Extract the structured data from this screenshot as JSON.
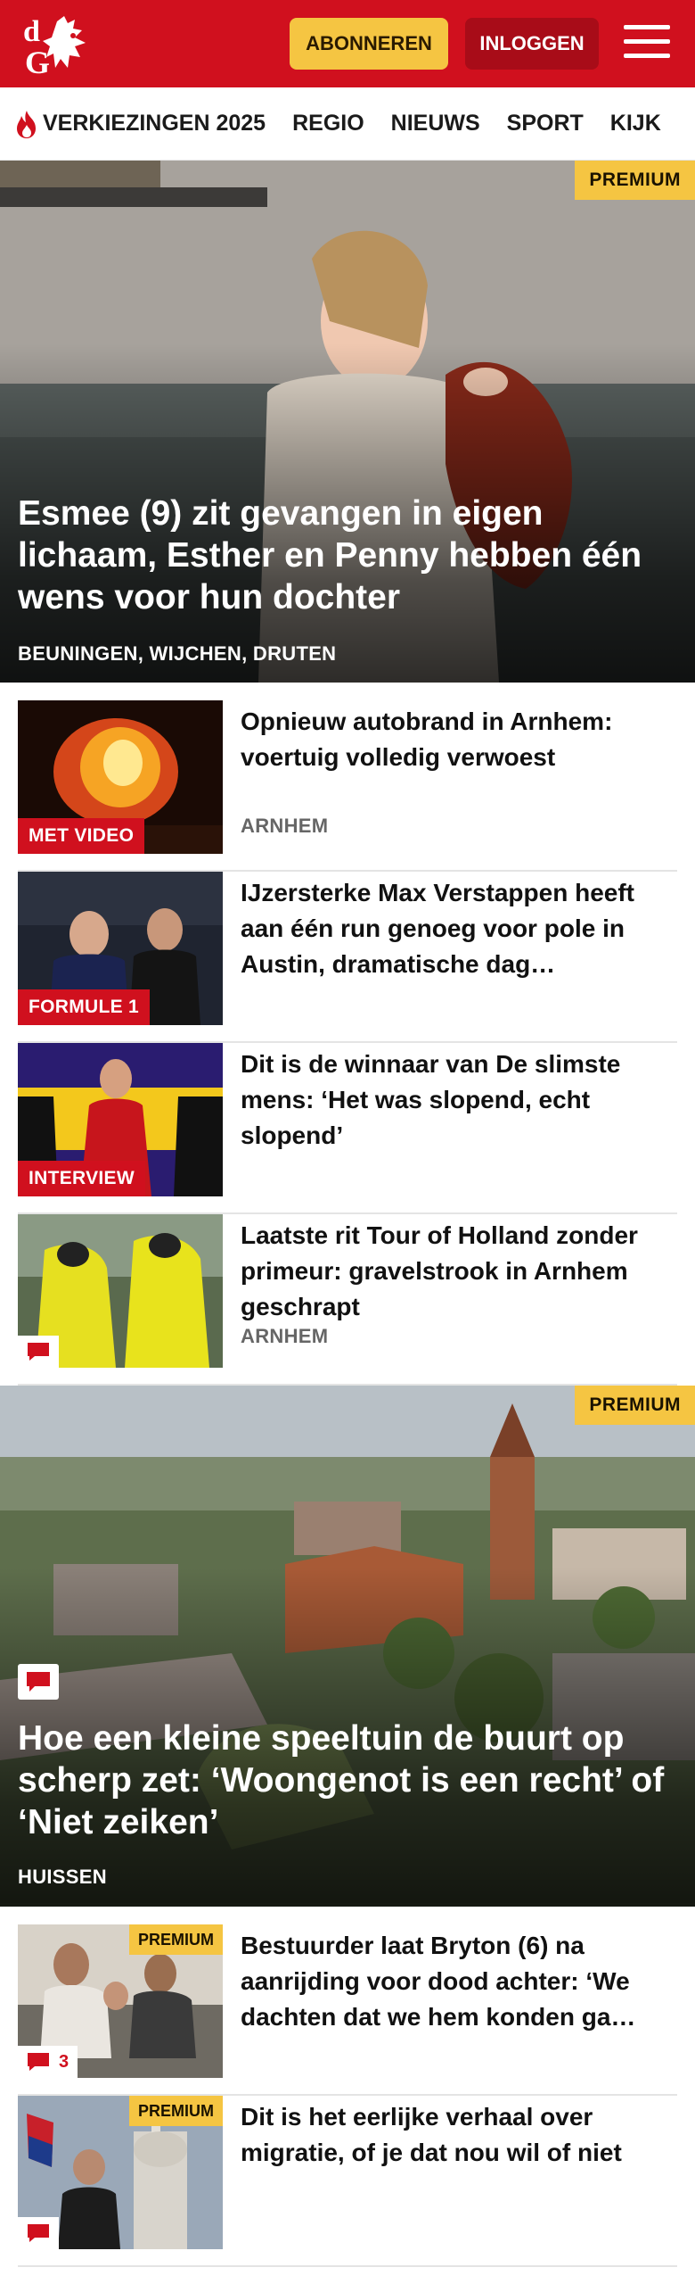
{
  "header": {
    "subscribe_label": "ABONNEREN",
    "login_label": "INLOGGEN",
    "menu_icon": "hamburger-menu-icon",
    "logo_text": "dG",
    "brand_color": "#d0101e",
    "accent_color": "#f5c542"
  },
  "nav": {
    "items": [
      {
        "label": "VERKIEZINGEN 2025",
        "icon": "flame-icon"
      },
      {
        "label": "REGIO"
      },
      {
        "label": "NIEUWS"
      },
      {
        "label": "SPORT"
      },
      {
        "label": "KIJK"
      }
    ]
  },
  "stories": {
    "hero1": {
      "badge": "PREMIUM",
      "title": "Esmee (9) zit gevangen in eigen lichaam, Esther en Penny hebben één wens voor hun dochter",
      "location": "BEUNINGEN, WIJCHEN, DRUTEN"
    },
    "list1": [
      {
        "label": "MET VIDEO",
        "title": "Opnieuw autobrand in Arnhem: voertuig volledig verwoest",
        "location": "ARNHEM"
      },
      {
        "label": "FORMULE 1",
        "title": "IJzersterke Max Verstappen heeft aan één run genoeg voor pole in Austin, dramatische dag…",
        "location": ""
      },
      {
        "label": "INTERVIEW",
        "title": "Dit is de winnaar van De slimste mens: ‘Het was slopend, echt slopend’",
        "location": ""
      },
      {
        "label": "",
        "title": "Laatste rit Tour of Holland zonder primeur: gravelstrook in Arnhem geschrapt",
        "location": "ARNHEM",
        "comment_icon": "comment-icon"
      }
    ],
    "hero2": {
      "badge": "PREMIUM",
      "title": "Hoe een kleine speeltuin de buurt op scherp zet: ‘Woongenot is een recht’ of ‘Niet zeiken’",
      "location": "HUISSEN",
      "comment_icon": "comment-icon"
    },
    "list2": [
      {
        "badge": "PREMIUM",
        "title": "Bestuurder laat Bryton (6) na aanrijding voor dood achter: ‘We dachten dat we hem konden ga…",
        "comments": "3"
      },
      {
        "badge": "PREMIUM",
        "title": "Dit is het eerlijke verhaal over migratie, of je dat nou wil of niet",
        "comments": ""
      }
    ]
  }
}
